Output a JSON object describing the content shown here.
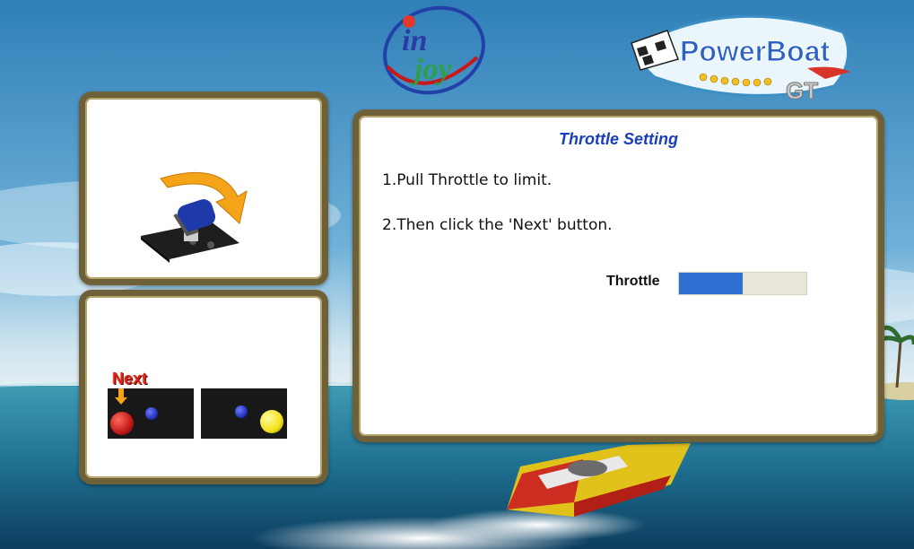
{
  "logos": {
    "injoy_line1": "in",
    "injoy_line2": "joy",
    "game_title": "PowerBoat",
    "game_subtitle": "GT"
  },
  "setup": {
    "title": "Throttle Setting",
    "step1": "1.Pull Throttle to limit.",
    "step2": "2.Then click the 'Next' button.",
    "throttle_label": "Throttle",
    "throttle_level_percent": 50
  },
  "buttons_hint": {
    "next_label": "Next",
    "next_button_color": "#c01818",
    "other_button_color": "#f2e21c",
    "small_button_color": "#1c2ab0"
  },
  "colors": {
    "panel_border": "#6e6038",
    "title_blue": "#1b3fb8",
    "throttle_fill": "#2f6fd2"
  }
}
